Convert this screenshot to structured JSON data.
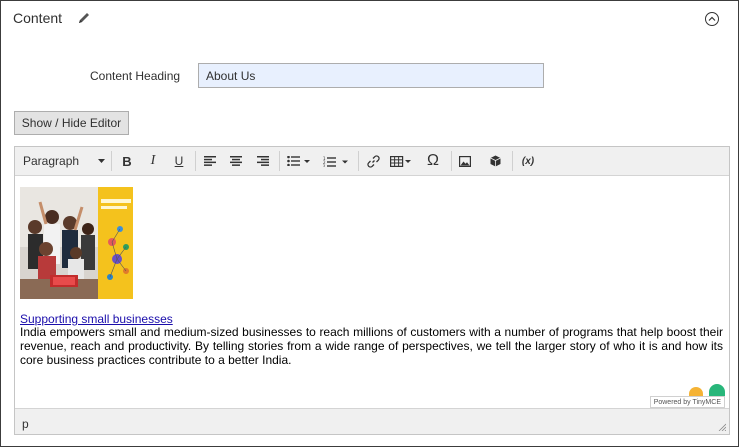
{
  "section": {
    "title": "Content"
  },
  "form": {
    "heading_label": "Content Heading",
    "heading_value": "About Us"
  },
  "toggle_button": {
    "label": "Show / Hide Editor"
  },
  "toolbar": {
    "format_value": "Paragraph",
    "bold": "B",
    "italic": "I",
    "underline": "U",
    "special_char": "Ω",
    "variable": "(x)",
    "buttons": [
      "bold",
      "italic",
      "underline",
      "align-left",
      "align-center",
      "align-right",
      "bullet-list",
      "numbered-list",
      "link",
      "table",
      "special-character",
      "image",
      "widget",
      "insert-variable"
    ]
  },
  "content": {
    "link_text": "Supporting small businesses",
    "paragraph": "India empowers small and medium-sized businesses to reach millions of customers with a number of programs that help boost their revenue, reach and productivity. By telling stories from a wide range of perspectives, we tell the larger story of who it is and how its core business practices contribute to a better India."
  },
  "statusbar": {
    "path": "p",
    "powered_by": "Powered by TinyMCE"
  },
  "colors": {
    "input_bg": "#e8f0fe",
    "link": "#1a0dab",
    "toolbar_bg": "#f0f0f0"
  }
}
